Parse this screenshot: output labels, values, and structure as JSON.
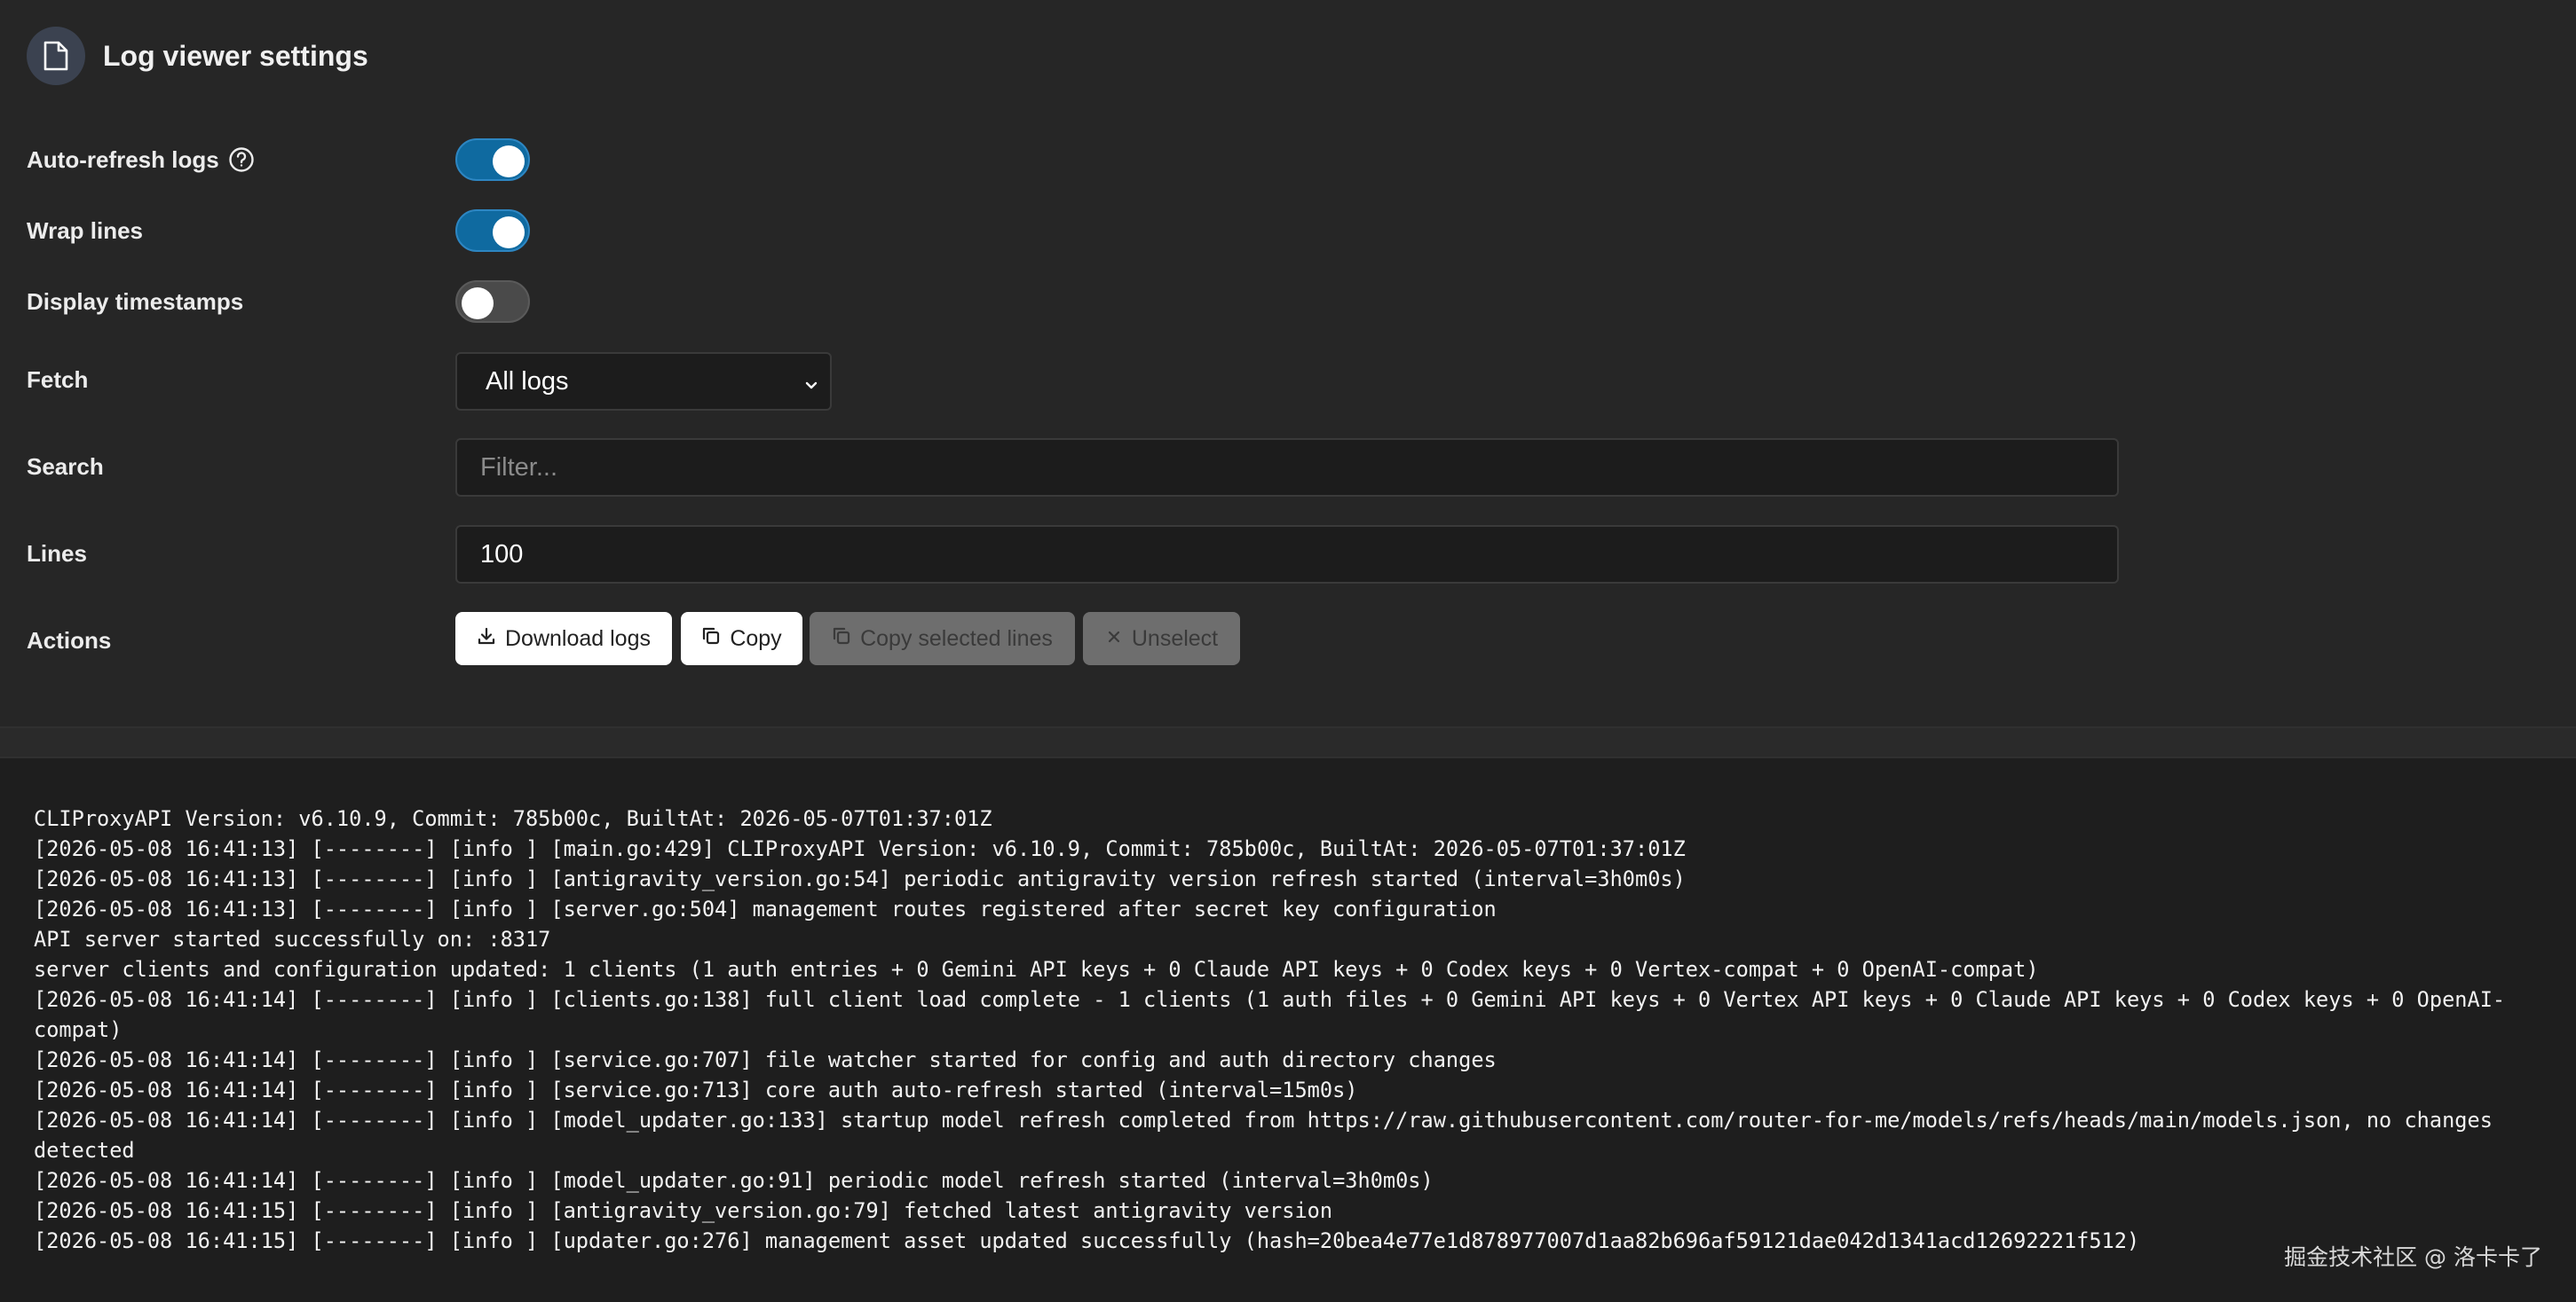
{
  "header": {
    "title": "Log viewer settings",
    "icon": "document-icon"
  },
  "settings": {
    "auto_refresh": {
      "label": "Auto-refresh logs",
      "enabled": true
    },
    "wrap_lines": {
      "label": "Wrap lines",
      "enabled": true
    },
    "display_timestamps": {
      "label": "Display timestamps",
      "enabled": false
    },
    "fetch": {
      "label": "Fetch",
      "selected": "All logs"
    },
    "search": {
      "label": "Search",
      "placeholder": "Filter...",
      "value": ""
    },
    "lines": {
      "label": "Lines",
      "value": "100"
    },
    "actions": {
      "label": "Actions",
      "download": "Download logs",
      "copy": "Copy",
      "copy_selected": "Copy selected lines",
      "unselect": "Unselect"
    }
  },
  "colors": {
    "accent": "#0f6aa0",
    "background": "#262626",
    "log_background": "#1e1e1e"
  },
  "log_lines": [
    "CLIProxyAPI Version: v6.10.9, Commit: 785b00c, BuiltAt: 2026-05-07T01:37:01Z",
    "[2026-05-08 16:41:13] [--------] [info ] [main.go:429] CLIProxyAPI Version: v6.10.9, Commit: 785b00c, BuiltAt: 2026-05-07T01:37:01Z",
    "[2026-05-08 16:41:13] [--------] [info ] [antigravity_version.go:54] periodic antigravity version refresh started (interval=3h0m0s)",
    "[2026-05-08 16:41:13] [--------] [info ] [server.go:504] management routes registered after secret key configuration",
    "API server started successfully on: :8317",
    "server clients and configuration updated: 1 clients (1 auth entries + 0 Gemini API keys + 0 Claude API keys + 0 Codex keys + 0 Vertex-compat + 0 OpenAI-compat)",
    "[2026-05-08 16:41:14] [--------] [info ] [clients.go:138] full client load complete - 1 clients (1 auth files + 0 Gemini API keys + 0 Vertex API keys + 0 Claude API keys + 0 Codex keys + 0 OpenAI-",
    "compat)",
    "[2026-05-08 16:41:14] [--------] [info ] [service.go:707] file watcher started for config and auth directory changes",
    "[2026-05-08 16:41:14] [--------] [info ] [service.go:713] core auth auto-refresh started (interval=15m0s)",
    "[2026-05-08 16:41:14] [--------] [info ] [model_updater.go:133] startup model refresh completed from https://raw.githubusercontent.com/router-for-me/models/refs/heads/main/models.json, no changes",
    "detected",
    "[2026-05-08 16:41:14] [--------] [info ] [model_updater.go:91] periodic model refresh started (interval=3h0m0s)",
    "[2026-05-08 16:41:15] [--------] [info ] [antigravity_version.go:79] fetched latest antigravity version",
    "[2026-05-08 16:41:15] [--------] [info ] [updater.go:276] management asset updated successfully (hash=20bea4e77e1d878977007d1aa82b696af59121dae042d1341acd12692221f512)"
  ],
  "watermark": "掘金技术社区 @ 洛卡卡了"
}
